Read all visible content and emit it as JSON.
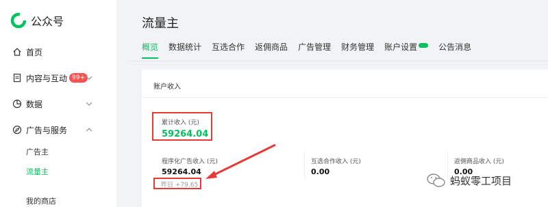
{
  "app": {
    "name": "公众号"
  },
  "sidebar": {
    "home": "首页",
    "content": "内容与互动",
    "content_badge": "99+",
    "data": "数据",
    "ads": "广告与服务",
    "advertiser": "广告主",
    "publisher": "流量主",
    "shop": "我的商店"
  },
  "page": {
    "title": "流量主"
  },
  "tabs": [
    "概览",
    "数据统计",
    "互选合作",
    "返佣商品",
    "广告管理",
    "财务管理",
    "账户设置",
    "公告消息"
  ],
  "account": {
    "title": "账户收入",
    "total_label": "累计收入 (元)",
    "total_value": "59264.04",
    "prog_label": "程序化广告收入 (元)",
    "prog_value": "59264.04",
    "prog_yesterday": "昨日 +79.65",
    "mutual_label": "互选合作收入 (元)",
    "mutual_value": "0.00",
    "rebate_label": "返佣商品收入 (元)",
    "rebate_value": "0.00"
  },
  "watermark": "蚂蚁零工项目",
  "colors": {
    "accent": "#07c160",
    "highlight": "#e53935",
    "badge": "#fa5151"
  }
}
